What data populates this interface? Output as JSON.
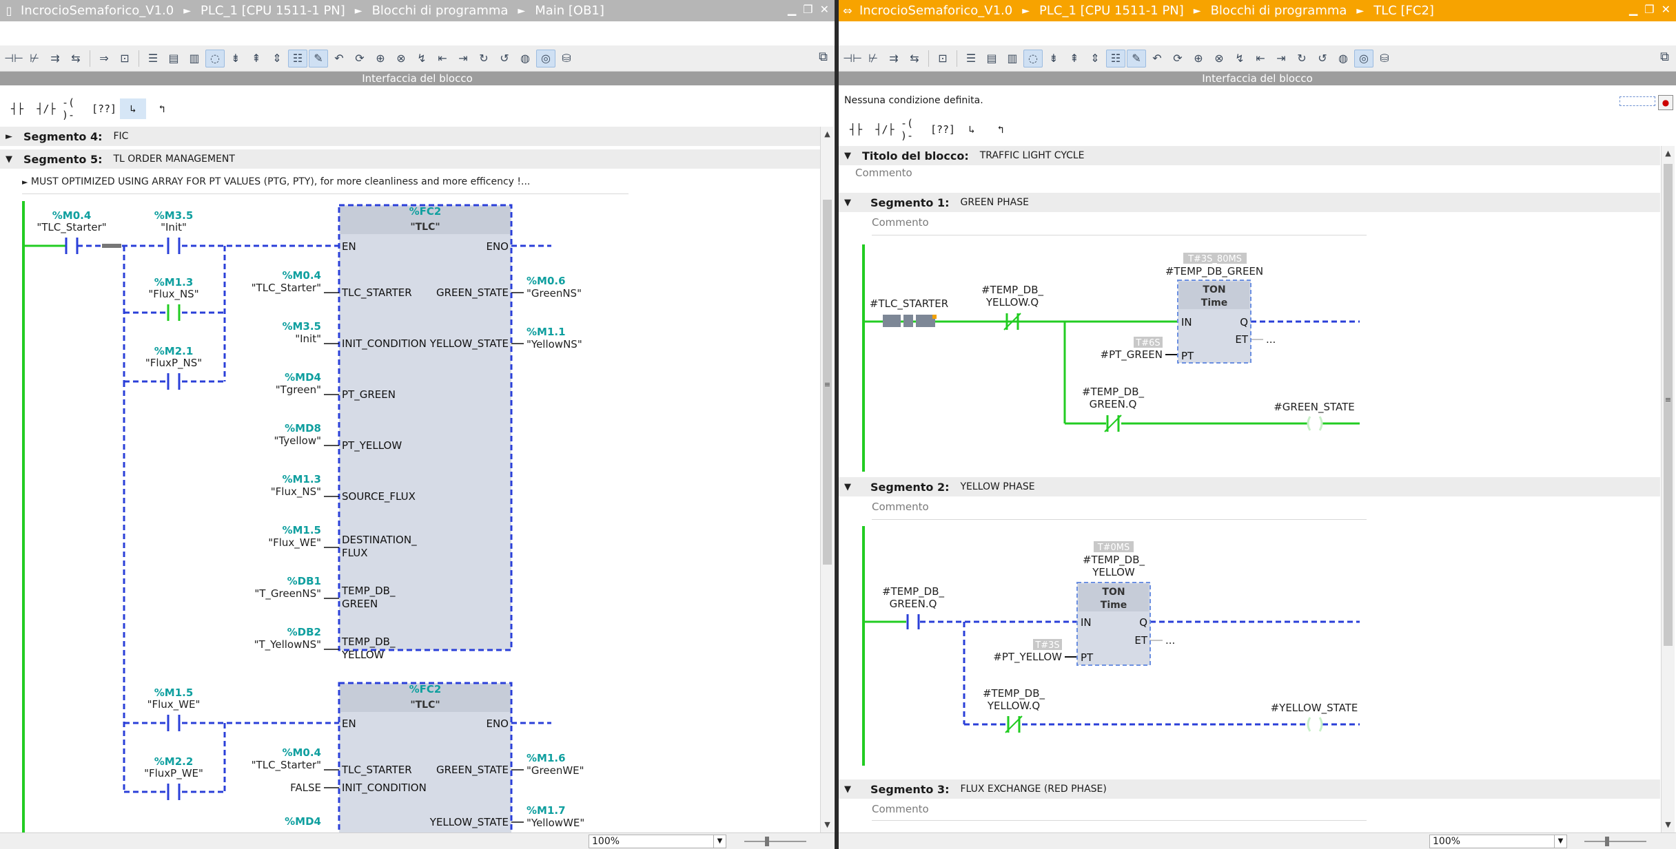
{
  "left": {
    "titlebar": {
      "crumbs": [
        "IncrocioSemaforico_V1.0",
        "PLC_1 [CPU 1511-1 PN]",
        "Blocchi di programma",
        "Main [OB1]"
      ]
    },
    "interface_label": "Interfaccia del blocco",
    "segments": [
      {
        "label": "Segmento 4:",
        "title": "FIC"
      },
      {
        "label": "Segmento 5:",
        "title": "TL ORDER MANAGEMENT"
      }
    ],
    "note": "MUST OPTIMIZED USING ARRAY FOR PT VALUES (PTG, PTY), for more cleanliness and more efficency !...",
    "lad": {
      "contacts": [
        {
          "op": "%M0.4",
          "name": "\"TLC_Starter\""
        },
        {
          "op": "%M3.5",
          "name": "\"Init\""
        },
        {
          "op": "%M1.3",
          "name": "\"Flux_NS\""
        },
        {
          "op": "%M2.1",
          "name": "\"FluxP_NS\""
        },
        {
          "op": "%M1.5",
          "name": "\"Flux_WE\""
        },
        {
          "op": "%M2.2",
          "name": "\"FluxP_WE\""
        }
      ],
      "block1": {
        "addr": "%FC2",
        "name": "\"TLC\"",
        "en": "EN",
        "eno": "ENO",
        "inputs": [
          {
            "op": "%M0.4",
            "name": "\"TLC_Starter\"",
            "pin": "TLC_STARTER"
          },
          {
            "op": "%M3.5",
            "name": "\"Init\"",
            "pin": "INIT_CONDITION"
          },
          {
            "op": "%MD4",
            "name": "\"Tgreen\"",
            "pin": "PT_GREEN"
          },
          {
            "op": "%MD8",
            "name": "\"Tyellow\"",
            "pin": "PT_YELLOW"
          },
          {
            "op": "%M1.3",
            "name": "\"Flux_NS\"",
            "pin": "SOURCE_FLUX"
          },
          {
            "op": "%M1.5",
            "name": "\"Flux_WE\"",
            "pin1": "DESTINATION_",
            "pin2": "FLUX"
          },
          {
            "op": "%DB1",
            "name": "\"T_GreenNS\"",
            "pin1": "TEMP_DB_",
            "pin2": "GREEN"
          },
          {
            "op": "%DB2",
            "name": "\"T_YellowNS\"",
            "pin1": "TEMP_DB_",
            "pin2": "YELLOW"
          }
        ],
        "outputs": [
          {
            "op": "%M0.6",
            "name": "\"GreenNS\"",
            "pin": "GREEN_STATE"
          },
          {
            "op": "%M1.1",
            "name": "\"YellowNS\"",
            "pin": "YELLOW_STATE"
          }
        ]
      },
      "block2": {
        "addr": "%FC2",
        "name": "\"TLC\"",
        "en": "EN",
        "eno": "ENO",
        "inputs": [
          {
            "op": "%M0.4",
            "name": "\"TLC_Starter\"",
            "pin": "TLC_STARTER"
          },
          {
            "literal": "FALSE",
            "pin": "INIT_CONDITION"
          },
          {
            "op": "%MD4"
          }
        ],
        "outputs": [
          {
            "op": "%M1.6",
            "name": "\"GreenWE\"",
            "pin": "GREEN_STATE"
          },
          {
            "op": "%M1.7",
            "name": "\"YellowWE\"",
            "pin": "YELLOW_STATE"
          }
        ]
      }
    },
    "zoom": "100%"
  },
  "right": {
    "titlebar": {
      "crumbs": [
        "IncrocioSemaforico_V1.0",
        "PLC_1 [CPU 1511-1 PN]",
        "Blocchi di programma",
        "TLC [FC2]"
      ]
    },
    "interface_label": "Interfaccia del blocco",
    "no_condition": "Nessuna condizione definita.",
    "block_title": {
      "label": "Titolo del blocco:",
      "title": "TRAFFIC LIGHT CYCLE",
      "comment": "Commento"
    },
    "segments": [
      {
        "label": "Segmento 1:",
        "title": "GREEN PHASE",
        "comment": "Commento"
      },
      {
        "label": "Segmento 2:",
        "title": "YELLOW PHASE",
        "comment": "Commento"
      },
      {
        "label": "Segmento 3:",
        "title": "FLUX EXCHANGE (RED PHASE)",
        "comment": "Commento"
      }
    ],
    "seg1": {
      "contact1": "#TLC_STARTER",
      "contact2a": "#TEMP_DB_",
      "contact2b": "YELLOW.Q",
      "timer_value": "T#3S_80MS",
      "timer_name": "#TEMP_DB_GREEN",
      "type": "TON",
      "type2": "Time",
      "in": "IN",
      "q": "Q",
      "et": "ET",
      "pt": "PT",
      "pt_value": "T#6S",
      "pt_var": "#PT_GREEN",
      "et_dots": "...",
      "contact3a": "#TEMP_DB_",
      "contact3b": "GREEN.Q",
      "coil": "#GREEN_STATE"
    },
    "seg2": {
      "contact1a": "#TEMP_DB_",
      "contact1b": "GREEN.Q",
      "timer_value": "T#0MS",
      "timer_name1": "#TEMP_DB_",
      "timer_name2": "YELLOW",
      "type": "TON",
      "type2": "Time",
      "in": "IN",
      "q": "Q",
      "et": "ET",
      "pt": "PT",
      "pt_value": "T#3S",
      "pt_var": "#PT_YELLOW",
      "et_dots": "...",
      "contact2a": "#TEMP_DB_",
      "contact2b": "YELLOW.Q",
      "coil": "#YELLOW_STATE"
    },
    "zoom": "100%"
  },
  "colors": {
    "accent_orange": "#f7a300",
    "power_green": "#22cc22",
    "inactive_blue": "#2a3fd8",
    "operand_teal": "#0f9f9f",
    "block_fill": "#d6dbe6"
  },
  "icons": [
    "dock-icon",
    "minimize-icon",
    "restore-icon",
    "close-icon",
    "normally-open-contact-icon",
    "normally-closed-contact-icon",
    "coil-icon",
    "empty-box-icon",
    "open-branch-icon",
    "close-branch-icon"
  ]
}
